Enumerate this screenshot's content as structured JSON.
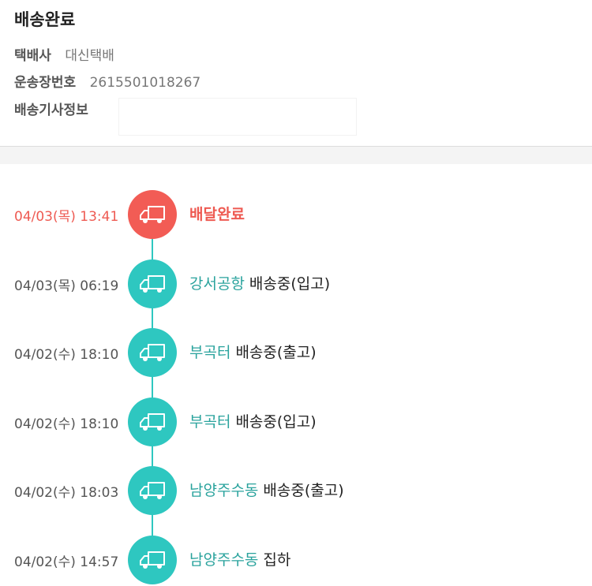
{
  "header": {
    "title": "배송완료",
    "carrier_label": "택배사",
    "carrier_value": "대신택배",
    "invoice_label": "운송장번호",
    "invoice_value": "2615501018267",
    "driver_label": "배송기사정보"
  },
  "colors": {
    "accent_teal": "#2ec7c0",
    "accent_red": "#f25c55"
  },
  "timeline": {
    "events": [
      {
        "time": "04/03(목) 13:41",
        "place": "배달완료",
        "status": "",
        "icon": "truck-icon",
        "current": true
      },
      {
        "time": "04/03(목) 06:19",
        "place": "강서공항",
        "status": "배송중(입고)",
        "icon": "truck-icon",
        "current": false
      },
      {
        "time": "04/02(수) 18:10",
        "place": "부곡터",
        "status": "배송중(출고)",
        "icon": "truck-icon",
        "current": false
      },
      {
        "time": "04/02(수) 18:10",
        "place": "부곡터",
        "status": "배송중(입고)",
        "icon": "truck-icon",
        "current": false
      },
      {
        "time": "04/02(수) 18:03",
        "place": "남양주수동",
        "status": "배송중(출고)",
        "icon": "truck-icon",
        "current": false
      },
      {
        "time": "04/02(수) 14:57",
        "place": "남양주수동",
        "status": "집하",
        "icon": "truck-icon",
        "current": false
      }
    ]
  }
}
